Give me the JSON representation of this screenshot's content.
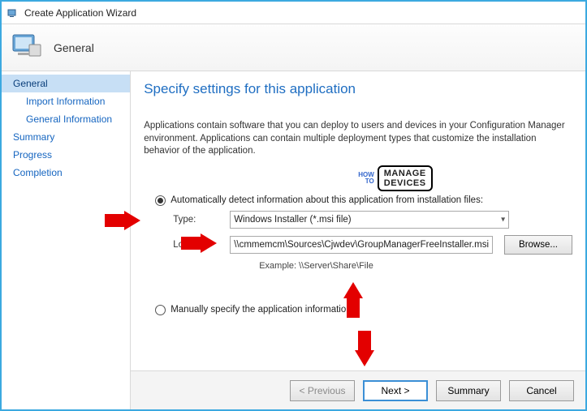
{
  "window": {
    "title": "Create Application Wizard"
  },
  "banner": {
    "title": "General"
  },
  "sidebar": {
    "items": [
      {
        "label": "General",
        "selected": true,
        "sub": false
      },
      {
        "label": "Import Information",
        "selected": false,
        "sub": true
      },
      {
        "label": "General Information",
        "selected": false,
        "sub": true
      },
      {
        "label": "Summary",
        "selected": false,
        "sub": false
      },
      {
        "label": "Progress",
        "selected": false,
        "sub": false
      },
      {
        "label": "Completion",
        "selected": false,
        "sub": false
      }
    ]
  },
  "content": {
    "heading": "Specify settings for this application",
    "description": "Applications contain software that you can deploy to users and devices in your Configuration Manager environment. Applications can contain multiple deployment types that customize the installation behavior of the application.",
    "option_auto": "Automatically detect information about this application from installation files:",
    "type_label": "Type:",
    "type_value": "Windows Installer (*.msi file)",
    "location_label": "Location:",
    "location_value": "\\\\cmmemcm\\Sources\\Cjwdev\\GroupManagerFreeInstaller.msi",
    "browse_label": "Browse...",
    "example": "Example: \\\\Server\\Share\\File",
    "option_manual": "Manually specify the application information"
  },
  "footer": {
    "previous": "< Previous",
    "next": "Next >",
    "summary": "Summary",
    "cancel": "Cancel"
  },
  "watermark": {
    "side1": "HOW",
    "side2": "TO",
    "box1": "MANAGE",
    "box2": "DEVICES"
  }
}
